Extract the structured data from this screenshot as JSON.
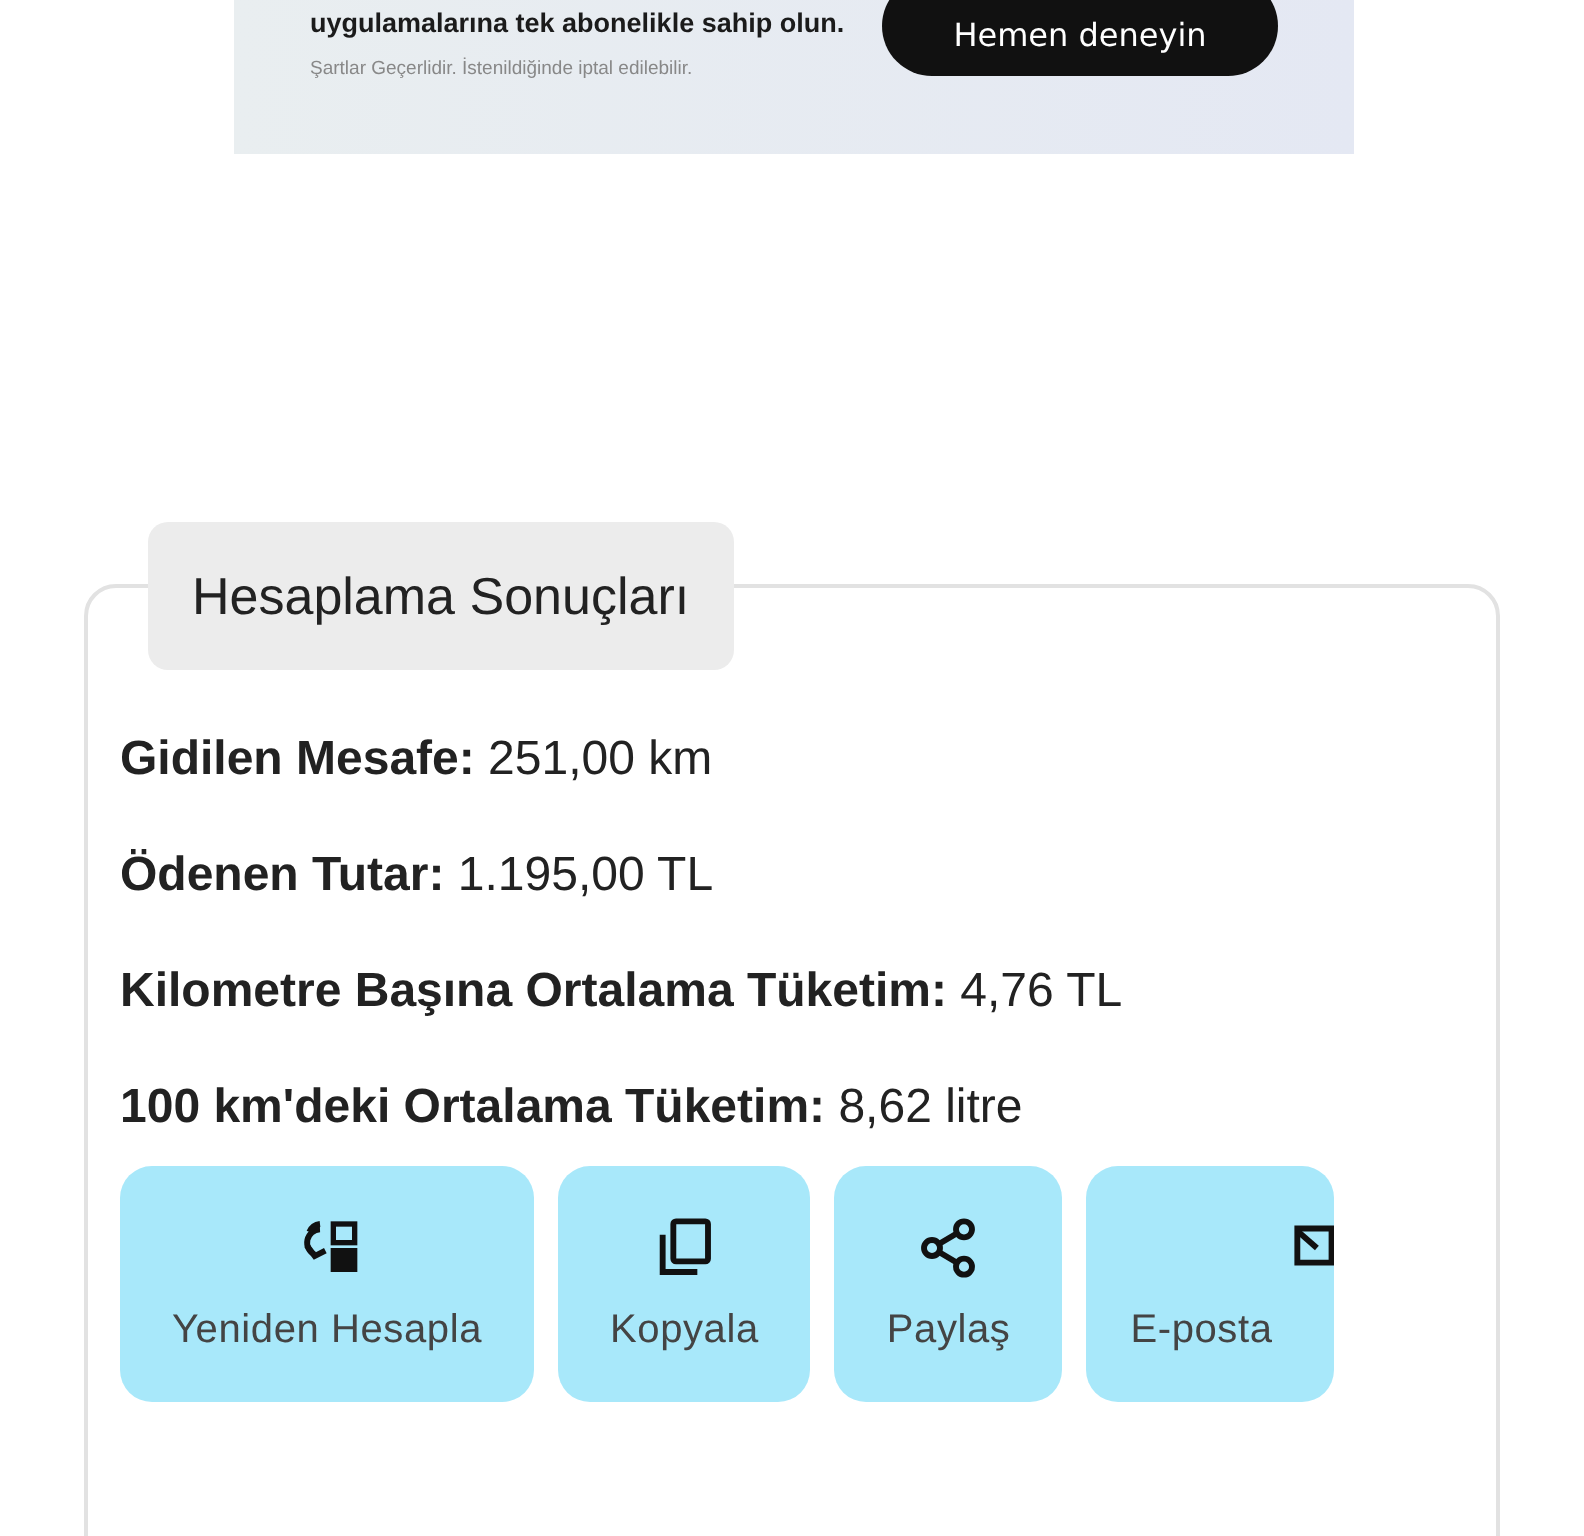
{
  "ad_banner": {
    "text": "uygulamalarına tek abonelikle sahip olun.",
    "terms": "Şartlar Geçerlidir. İstenildiğinde iptal edilebilir.",
    "button": "Hemen deneyin"
  },
  "results": {
    "title": "Hesaplama Sonuçları",
    "rows": [
      {
        "label": "Gidilen Mesafe:",
        "value": "251,00 km"
      },
      {
        "label": "Ödenen Tutar:",
        "value": "1.195,00 TL"
      },
      {
        "label": "Kilometre Başına Ortalama Tüketim:",
        "value": "4,76 TL"
      },
      {
        "label": "100 km'deki Ortalama Tüketim:",
        "value": "8,62 litre"
      }
    ],
    "actions": [
      {
        "kind": "recalculate",
        "label": "Yeniden Hesapla"
      },
      {
        "kind": "copy",
        "label": "Kopyala"
      },
      {
        "kind": "share",
        "label": "Paylaş"
      },
      {
        "kind": "email",
        "label": "E-posta"
      }
    ]
  }
}
